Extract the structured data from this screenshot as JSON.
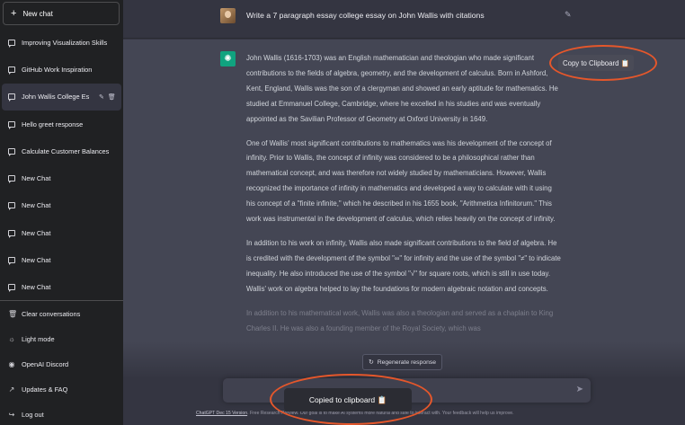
{
  "sidebar": {
    "new_chat_label": "New chat",
    "conversations": [
      {
        "label": "Improving Visualization Skills",
        "active": false
      },
      {
        "label": "GitHub Work Inspiration",
        "active": false
      },
      {
        "label": "John Wallis College Es",
        "active": true
      },
      {
        "label": "Hello greet response",
        "active": false
      },
      {
        "label": "Calculate Customer Balances",
        "active": false
      },
      {
        "label": "New Chat",
        "active": false
      },
      {
        "label": "New Chat",
        "active": false
      },
      {
        "label": "New Chat",
        "active": false
      },
      {
        "label": "New Chat",
        "active": false
      },
      {
        "label": "New Chat",
        "active": false
      }
    ],
    "menu": {
      "clear": "Clear conversations",
      "light": "Light mode",
      "discord": "OpenAI Discord",
      "faq": "Updates & FAQ",
      "logout": "Log out"
    }
  },
  "chat": {
    "user_prompt": "Write a 7 paragraph essay college essay on John Wallis with citations",
    "paragraphs": [
      "John Wallis (1616-1703) was an English mathematician and theologian who made significant contributions to the fields of algebra, geometry, and the development of calculus. Born in Ashford, Kent, England, Wallis was the son of a clergyman and showed an early aptitude for mathematics. He studied at Emmanuel College, Cambridge, where he excelled in his studies and was eventually appointed as the Savilian Professor of Geometry at Oxford University in 1649.",
      "One of Wallis' most significant contributions to mathematics was his development of the concept of infinity. Prior to Wallis, the concept of infinity was considered to be a philosophical rather than mathematical concept, and was therefore not widely studied by mathematicians. However, Wallis recognized the importance of infinity in mathematics and developed a way to calculate with it using his concept of a \"finite infinite,\" which he described in his 1655 book, \"Arithmetica Infinitorum.\" This work was instrumental in the development of calculus, which relies heavily on the concept of infinity.",
      "In addition to his work on infinity, Wallis also made significant contributions to the field of algebra. He is credited with the development of the symbol \"∞\" for infinity and the use of the symbol \"≠\" to indicate inequality. He also introduced the use of the symbol \"√\" for square roots, which is still in use today. Wallis' work on algebra helped to lay the foundations for modern algebraic notation and concepts.",
      "In addition to his mathematical work, Wallis was also a theologian and served as a chaplain to King Charles II. He was also a founding member of the Royal Society, which was"
    ],
    "copy_button_label": "Copy to Clipboard 📋",
    "regenerate_label": "Regenerate response",
    "input_placeholder": "",
    "footer_link": "ChatGPT Dec 15 Version",
    "footer_text": ". Free Research Preview. Our goal is to make AI systems more natural and safe to interact with. Your feedback will help us improve.",
    "toast_label": "Copied to clipboard 📋"
  },
  "colors": {
    "accent_green": "#10a37f",
    "annotation_ring": "#e5572b",
    "sidebar_bg": "#202123",
    "chat_bg": "#343541",
    "answer_bg": "#444654"
  }
}
